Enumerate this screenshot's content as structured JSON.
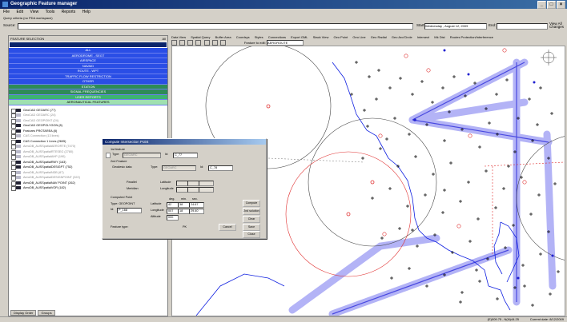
{
  "window": {
    "title": "Geographic Feature manager"
  },
  "menu": [
    "File",
    "Edit",
    "View",
    "Tools",
    "Reports",
    "Help"
  ],
  "query": {
    "label": "Query criteria (no PDA workspace)",
    "source_label": "Source:",
    "start_label": "Start:",
    "start_value": "Wednesday , August 12, 2009",
    "end_label": "End:",
    "view_all_label": "View All Changes"
  },
  "left_panel": {
    "header": "FEATURE SELECTION",
    "all_btn": "All",
    "categories": [
      {
        "label": "ALL",
        "style": "blue"
      },
      {
        "label": "AERODROME - SEGT",
        "style": "blue"
      },
      {
        "label": "AIRSPACE",
        "style": "blue"
      },
      {
        "label": "NAVAID",
        "style": "blue"
      },
      {
        "label": "ROUTE - WPT",
        "style": "blue"
      },
      {
        "label": "TRAFFIC FLOW RESTRICTION",
        "style": "blue"
      },
      {
        "label": "OTHER",
        "style": "blue"
      },
      {
        "label": "STATION",
        "style": "green"
      },
      {
        "label": "SIGNAL FREQUENCIES",
        "style": "green"
      },
      {
        "label": "USER REPORTS",
        "style": "green2"
      },
      {
        "label": "AERONAUTICAL FEATURES",
        "style": "last"
      }
    ],
    "layers": [
      {
        "label": "GeoCAD GEOARC (77)",
        "grey": false
      },
      {
        "label": "GeoCAD GEOARC (24)",
        "grey": true
      },
      {
        "label": "GeoCAD GEOPOINT (24)",
        "grey": true
      },
      {
        "label": "GeoCAD GEOPOLYGON (8)",
        "grey": false
      },
      {
        "label": "Features PROTAREA (8)",
        "grey": false
      },
      {
        "label": "CAS Connection (13 lines)",
        "grey": true
      },
      {
        "label": "CAS Connection 1 Lines (2605)",
        "grey": false
      },
      {
        "label": "AeroDB_AUSSpatialAERORTE (7470)",
        "grey": true
      },
      {
        "label": "AeroDB_AUSSpatialRTESEG (2780)",
        "grey": true
      },
      {
        "label": "AeroDB_AUSSpatialAHP (190)",
        "grey": true
      },
      {
        "label": "AeroDB_AUSSpatialRWY (163)",
        "grey": false
      },
      {
        "label": "AeroDB_AUSSpatialDESIGPT (752)",
        "grey": false
      },
      {
        "label": "AeroDB_AUSSpatialNDB (67)",
        "grey": true
      },
      {
        "label": "AeroDB_AUSSpatialDESIGNPOINT (322)",
        "grey": true
      },
      {
        "label": "AeroDB_AUSSpatialNAV POINT (262)",
        "grey": false
      },
      {
        "label": "AeroDB_AUSSpatialVOR (182)",
        "grey": false
      }
    ],
    "tabs": [
      "Display Order",
      "Groups"
    ]
  },
  "map_toolbar": {
    "tabs": [
      "Data View",
      "Spatial Query",
      "Buffer Area",
      "Coordsys",
      "Styles",
      "Connections",
      "Export GML",
      "Stack View",
      "Geo Point",
      "Geo Line",
      "Geo Radial",
      "Geo Arc/Circle",
      "Intersect",
      "Mk Dist",
      "Routes Protection/Interference"
    ],
    "feature_label": "Feature to edit:",
    "feature_value": "AEROROUTE"
  },
  "dialog": {
    "title": "Compute Intersection Point",
    "first_feature": "1st feature",
    "type_label": "Type:",
    "type1_value": "GEOARC",
    "id_label": "Id:",
    "id1_value": "C_77",
    "second_feature": "2nd Feature",
    "geodesic_label": "Geodesic data",
    "type2_value": "GEOARC",
    "id2_value": "C_78",
    "parallel_label": "Parallel",
    "meridian_label": "Meridian",
    "latitude_label": "Latitude",
    "longitude_label": "Longitude",
    "computed_label": "Computed Point",
    "type_geo": "Type: GEOPOINT",
    "id3_label": "Id:",
    "id3_value": "P_168",
    "deg_label": "deg.",
    "min_label": "min.",
    "sec_label": "sec.",
    "lat_row": [
      "42",
      "38",
      "24.67"
    ],
    "lon_row": [
      "007",
      "18",
      "29.40"
    ],
    "alt_label": "Altitude",
    "alt_value": "000",
    "feature_type_label": "Feature type:",
    "feature_type_value": "PK",
    "btn_compute": "Compute",
    "btn_2nd": "2nd solution",
    "btn_clear": "Clear",
    "btn_save": "Save",
    "btn_cancel": "Cancel",
    "btn_close": "Close"
  },
  "status": {
    "coords": "(E)009.75 , N(N)44.25",
    "date": "Current date: 8/12/2009"
  },
  "colors": {
    "route_band": "#8a8af0",
    "route_dark": "#3a3ad8",
    "coast": "#1020e0",
    "circle_red": "#e03030"
  }
}
